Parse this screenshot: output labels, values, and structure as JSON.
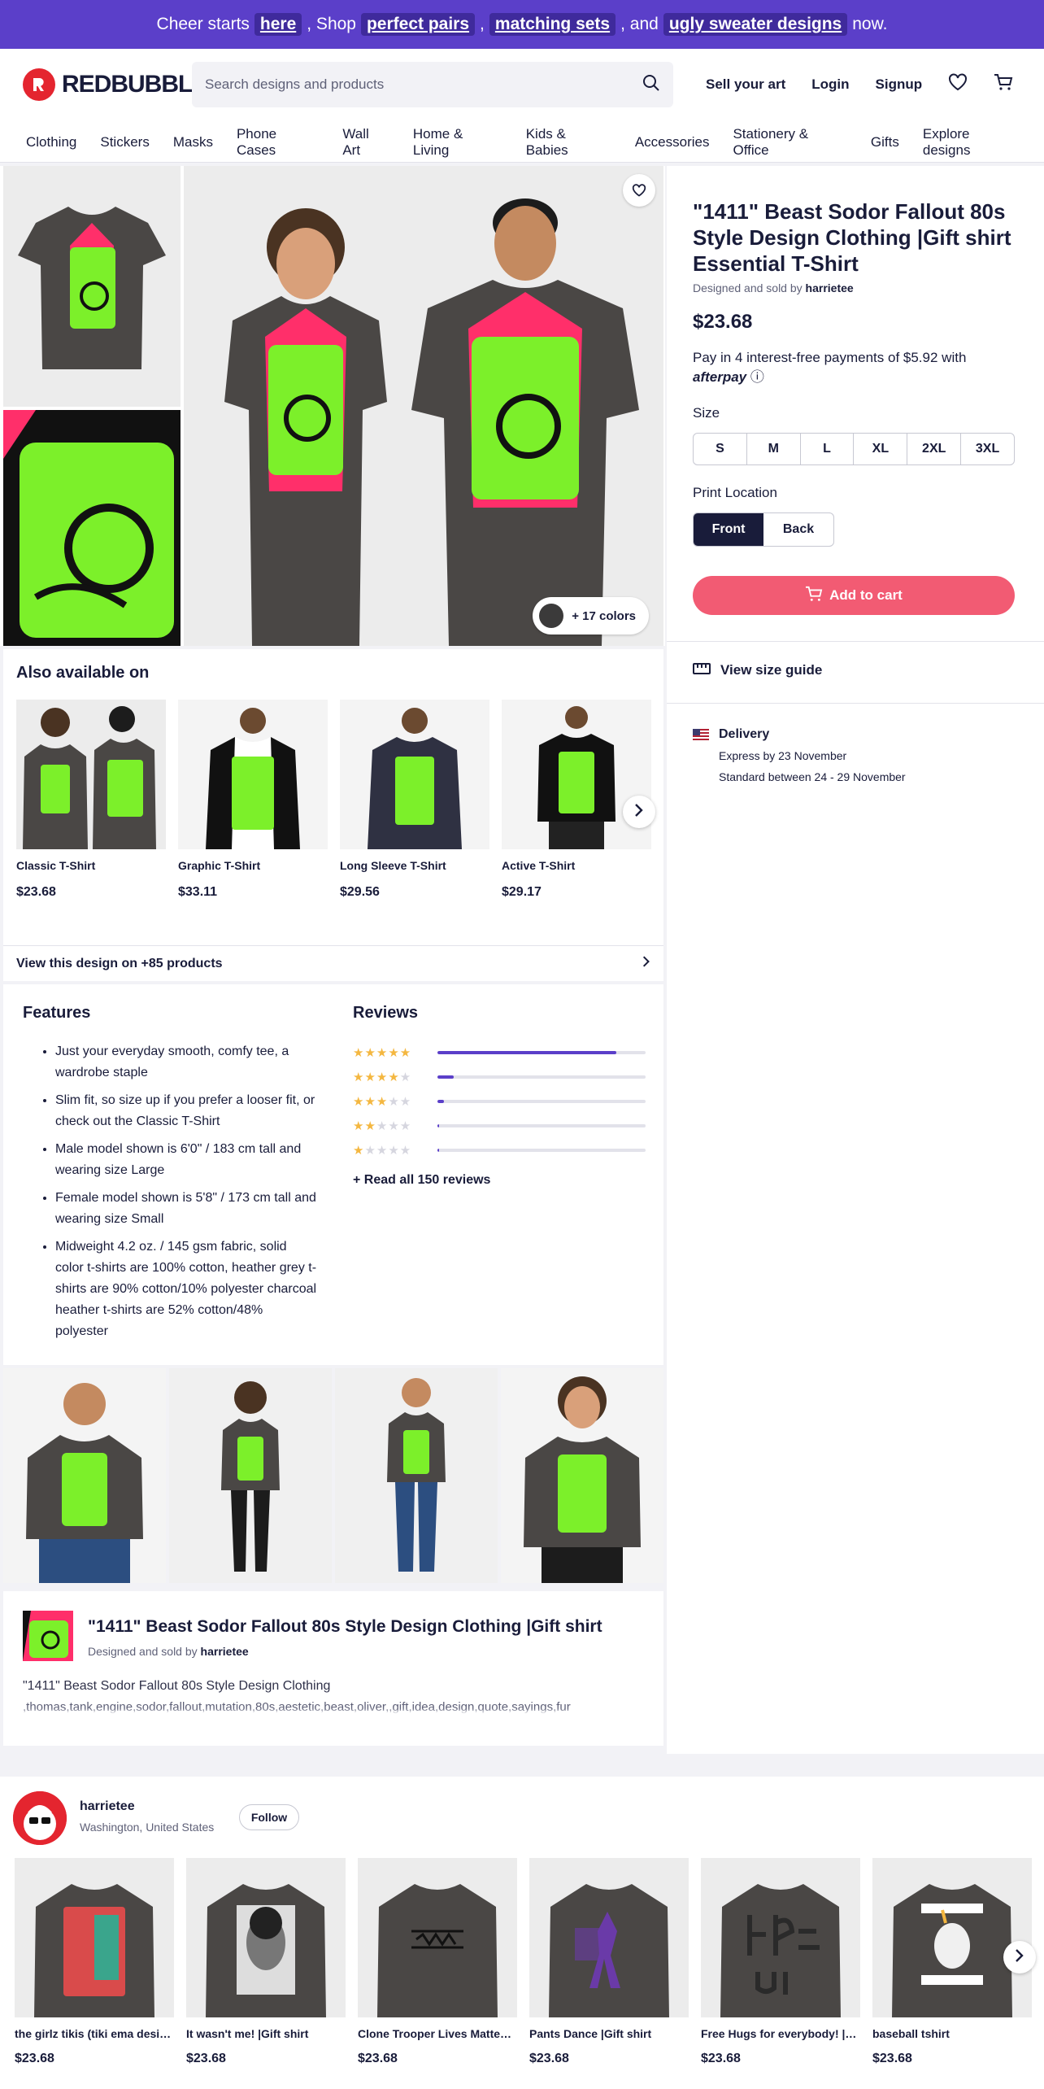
{
  "banner": {
    "pre": "Cheer starts",
    "link1": "here",
    "mid1": ", Shop",
    "link2": "perfect pairs",
    "comma": ",",
    "link3": "matching sets",
    "mid2": ", and",
    "link4": "ugly sweater designs",
    "post": "now."
  },
  "header": {
    "logo_text": "REDBUBBLE",
    "search_placeholder": "Search designs and products",
    "sell": "Sell your art",
    "login": "Login",
    "signup": "Signup"
  },
  "categories": [
    "Clothing",
    "Stickers",
    "Masks",
    "Phone Cases",
    "Wall Art",
    "Home & Living",
    "Kids & Babies",
    "Accessories",
    "Stationery & Office",
    "Gifts",
    "Explore designs"
  ],
  "gallery": {
    "colors_label": "+ 17 colors"
  },
  "product": {
    "title": "\"1411\" Beast Sodor Fallout 80s Style Design Clothing |Gift shirt Essential T-Shirt",
    "by_prefix": "Designed and sold by",
    "artist": "harrietee",
    "price": "$23.68",
    "afterpay_text": "Pay in 4 interest-free payments of $5.92 with",
    "afterpay_brand": "afterpay",
    "size_label": "Size",
    "sizes": [
      "S",
      "M",
      "L",
      "XL",
      "2XL",
      "3XL"
    ],
    "print_label": "Print Location",
    "print_options": [
      "Front",
      "Back"
    ],
    "add_to_cart": "Add to cart",
    "size_guide": "View size guide",
    "delivery_title": "Delivery",
    "delivery_express": "Express by 23 November",
    "delivery_standard": "Standard between 24 - 29 November"
  },
  "also": {
    "title": "Also available on",
    "items": [
      {
        "name": "Classic T-Shirt",
        "price": "$23.68"
      },
      {
        "name": "Graphic T-Shirt",
        "price": "$33.11"
      },
      {
        "name": "Long Sleeve T-Shirt",
        "price": "$29.56"
      },
      {
        "name": "Active T-Shirt",
        "price": "$29.17"
      }
    ],
    "view_all": "View this design on +85 products"
  },
  "features": {
    "title": "Features",
    "items": [
      "Just your everyday smooth, comfy tee, a wardrobe staple",
      "Slim fit, so size up if you prefer a looser fit, or check out the Classic T-Shirt",
      "Male model shown is 6'0\" / 183 cm tall and wearing size Large",
      "Female model shown is 5'8\" / 173 cm tall and wearing size Small",
      "Midweight 4.2 oz. / 145 gsm fabric, solid color t-shirts are 100% cotton, heather grey t-shirts are 90% cotton/10% polyester charcoal heather t-shirts are 52% cotton/48% polyester"
    ]
  },
  "reviews": {
    "title": "Reviews",
    "rows": [
      {
        "stars": 5,
        "fill": 0.86
      },
      {
        "stars": 4,
        "fill": 0.08
      },
      {
        "stars": 3,
        "fill": 0.03
      },
      {
        "stars": 2,
        "fill": 0.005
      },
      {
        "stars": 1,
        "fill": 0.005
      }
    ],
    "read_all": "+ Read all 150 reviews"
  },
  "design": {
    "title": "\"1411\" Beast Sodor Fallout 80s Style Design Clothing |Gift shirt",
    "by_prefix": "Designed and sold by",
    "artist": "harrietee",
    "description": "\"1411\" Beast Sodor Fallout 80s Style Design Clothing",
    "tags": ",thomas,tank,engine,sodor,fallout,mutation,80s,aestetic,beast,oliver,,gift,idea,design,quote,sayings,fur"
  },
  "artist_section": {
    "name": "harrietee",
    "location": "Washington, United States",
    "follow": "Follow",
    "items": [
      {
        "name": "the girlz tikis (tiki ema desi…",
        "price": "$23.68"
      },
      {
        "name": "It wasn't me! |Gift shirt",
        "price": "$23.68"
      },
      {
        "name": "Clone Trooper Lives Matte…",
        "price": "$23.68"
      },
      {
        "name": "Pants Dance |Gift shirt",
        "price": "$23.68"
      },
      {
        "name": "Free Hugs for everybody! |…",
        "price": "$23.68"
      },
      {
        "name": "baseball tshirt",
        "price": "$23.68"
      }
    ]
  },
  "colors": {
    "brand_red": "#e4252f",
    "banner_purple": "#5b3fc9",
    "cart_pink": "#f25b73",
    "navy": "#191c3a",
    "shirt_charcoal": "#4a4745",
    "print_green": "#7cf02a",
    "print_pink": "#ff2f6a"
  },
  "icons": [
    "search-icon",
    "heart-icon",
    "cart-icon",
    "chevron-right-icon",
    "ruler-icon",
    "info-icon",
    "us-flag-icon"
  ]
}
